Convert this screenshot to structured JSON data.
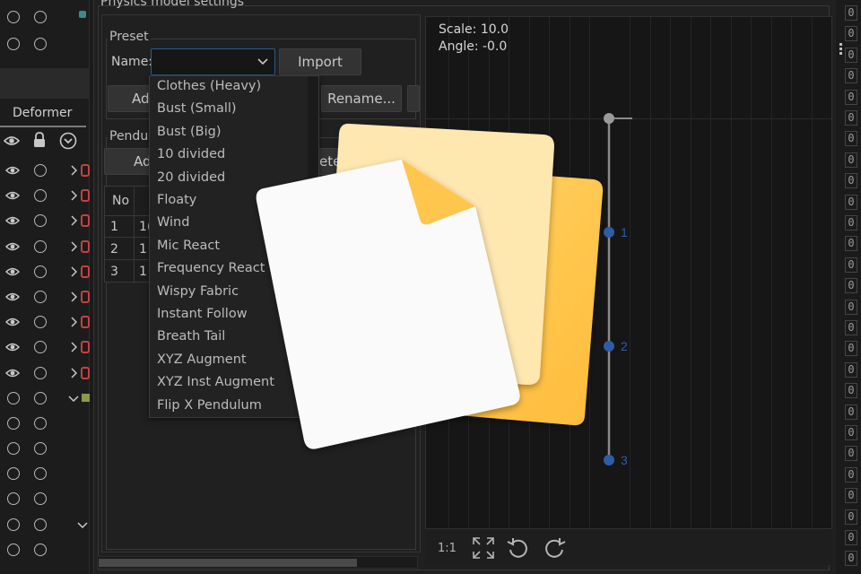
{
  "colors": {
    "accent": "#2c5a8a",
    "point_blue": "#2e5da8",
    "icon_red": "#c24242",
    "icon_green": "#8a9a4a"
  },
  "left_panel": {
    "tab": "Deformer",
    "header_icons": [
      "eye-icon",
      "lock-icon",
      "chevron-down-circle-icon"
    ]
  },
  "dialog": {
    "title": "Physics model settings",
    "preset": {
      "group_label": "Preset",
      "name_label": "Name:",
      "name_value": "",
      "import_label": "Import",
      "add_label": "Add",
      "rename_label": "Rename..."
    },
    "pendulum": {
      "group_label": "Pendul",
      "add_label": "Ad",
      "delete_label": "ete"
    },
    "table": {
      "header_no": "No",
      "header_col2": "",
      "rows": [
        {
          "no": "1",
          "val": "1("
        },
        {
          "no": "2",
          "val": "1"
        },
        {
          "no": "3",
          "val": "1"
        }
      ]
    },
    "dropdown_options": [
      "Clothes (Heavy)",
      "Bust (Small)",
      "Bust (Big)",
      "10 divided",
      "20 divided",
      "Floaty",
      "Wind",
      "Mic React",
      "Frequency React",
      "Wispy Fabric",
      "Instant Follow",
      "Breath Tail",
      "XYZ Augment",
      "XYZ Inst Augment",
      "Flip X Pendulum"
    ]
  },
  "canvas": {
    "scale_text": "Scale: 10.0",
    "angle_text": "Angle: -0.0",
    "points": [
      {
        "label": "1"
      },
      {
        "label": "2"
      },
      {
        "label": "3"
      }
    ],
    "bottom": {
      "ratio_label": "1:1"
    }
  },
  "right_strip": {
    "value": "0"
  }
}
